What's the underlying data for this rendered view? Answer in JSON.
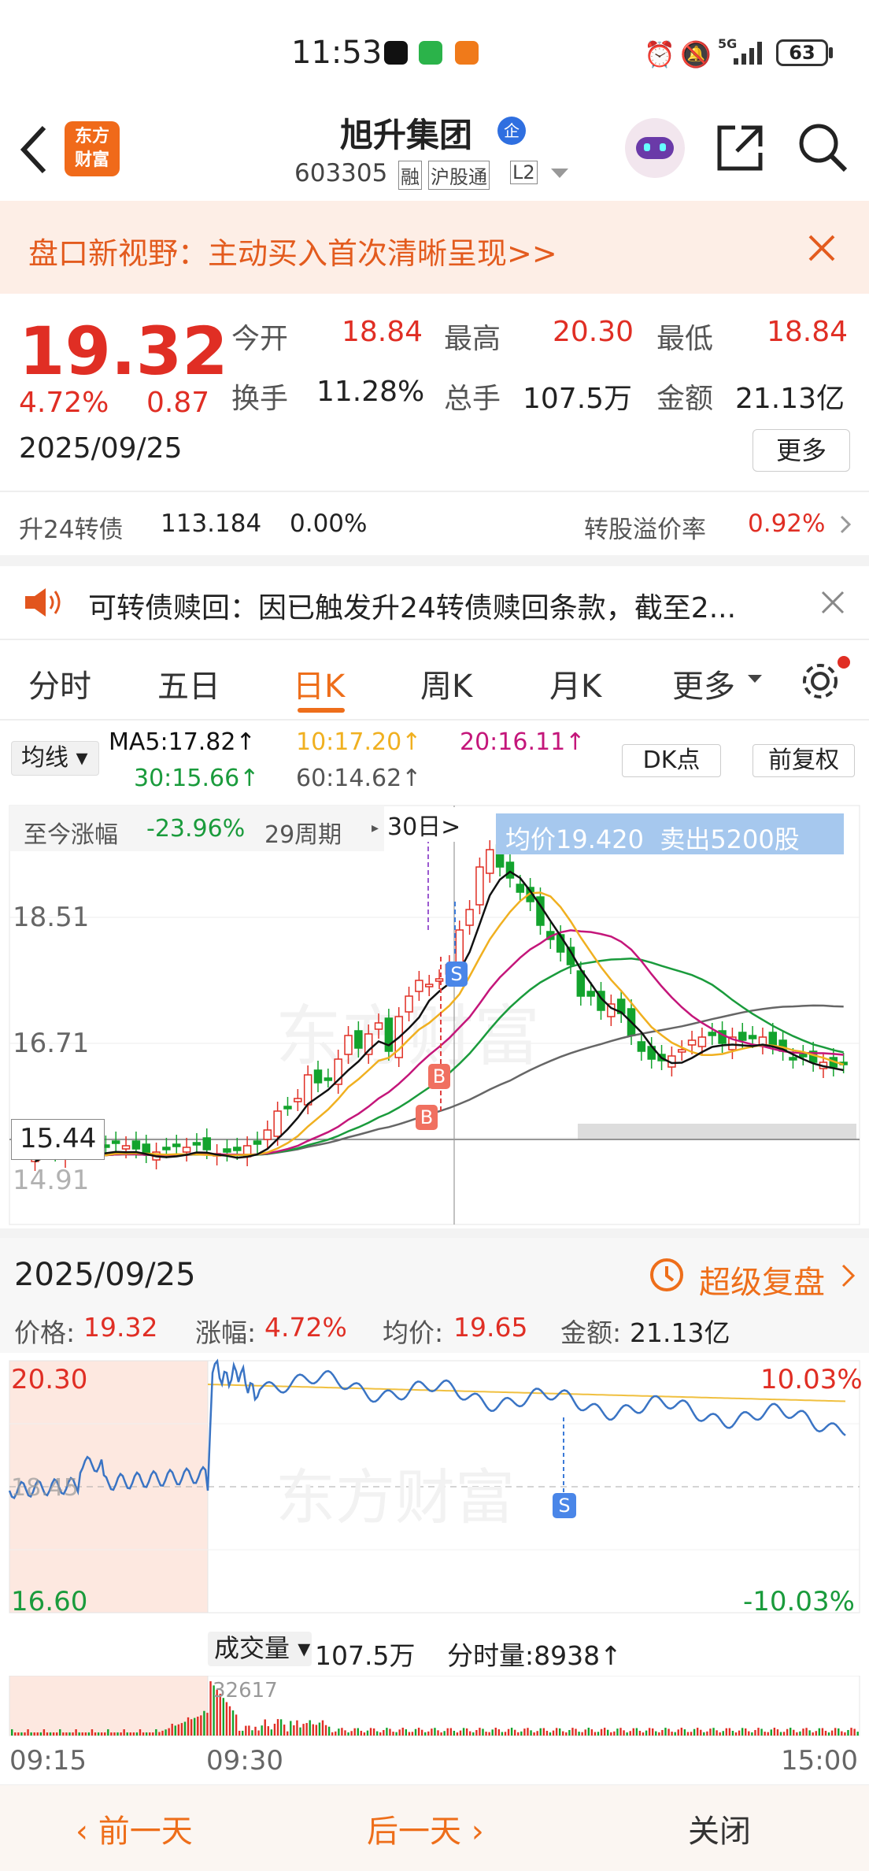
{
  "status_bar": {
    "time": "11:53",
    "battery": "63",
    "signal": "5G"
  },
  "header": {
    "logo_line1": "东方",
    "logo_line2": "财富",
    "title": "旭升集团",
    "title_badge": "企",
    "code": "603305",
    "tag1": "融",
    "tag2": "沪股通",
    "tag3": "L2"
  },
  "banner": {
    "text": "盘口新视野：主动买入首次清晰呈现>>"
  },
  "quote": {
    "price": "19.32",
    "change_pct": "4.72%",
    "change": "0.87",
    "date": "2025/09/25",
    "open_label": "今开",
    "open": "18.84",
    "high_label": "最高",
    "high": "20.30",
    "low_label": "最低",
    "low": "18.84",
    "turnover_label": "换手",
    "turnover": "11.28%",
    "volume_label": "总手",
    "volume": "107.5万",
    "amount_label": "金额",
    "amount": "21.13亿",
    "more": "更多"
  },
  "bond": {
    "name": "升24转债",
    "price": "113.184",
    "change": "0.00%",
    "premium_label": "转股溢价率",
    "premium": "0.92%"
  },
  "notice": {
    "text": "可转债赎回：因已触发升24转债赎回条款，截至2..."
  },
  "tabs": [
    "分时",
    "五日",
    "日K",
    "周K",
    "月K",
    "更多"
  ],
  "active_tab": "日K",
  "ma_bar": {
    "selector": "均线",
    "ma5": "MA5:17.82↑",
    "ma10": "10:17.20↑",
    "ma20": "20:16.11↑",
    "ma30": "30:15.66↑",
    "ma60": "60:14.62↑",
    "dk": "DK点",
    "adjust": "前复权",
    "ma5_color": "#111111",
    "ma10_color": "#f0b020",
    "ma20_color": "#c4167a",
    "ma30_color": "#1a9b3c",
    "ma60_color": "#666666"
  },
  "kline": {
    "range_label": "至今涨幅",
    "range_value": "-23.96%",
    "period": "29周期",
    "marker": "30日>",
    "tooltip": "均价19.420  卖出5200股",
    "y_labels": [
      "18.51",
      "16.71",
      "15.44",
      "14.91"
    ],
    "watermark": "东方财富"
  },
  "detail": {
    "date": "2025/09/25",
    "replay": "超级复盘",
    "price_label": "价格:",
    "price": "19.32",
    "chg_label": "涨幅:",
    "chg": "4.72%",
    "avg_label": "均价:",
    "avg": "19.65",
    "amt_label": "金额:",
    "amt": "21.13亿"
  },
  "intraday": {
    "high": "20.30",
    "low": "16.60",
    "mid": "18.45",
    "high_pct": "10.03%",
    "low_pct": "-10.03%",
    "watermark": "东方财富"
  },
  "volume": {
    "selector": "成交量",
    "total": "107.5万",
    "tick": "分时量:8938↑",
    "peak": "32617"
  },
  "time_axis": [
    "09:15",
    "09:30",
    "15:00"
  ],
  "footer": {
    "prev": "前一天",
    "next": "后一天",
    "close": "关闭"
  }
}
